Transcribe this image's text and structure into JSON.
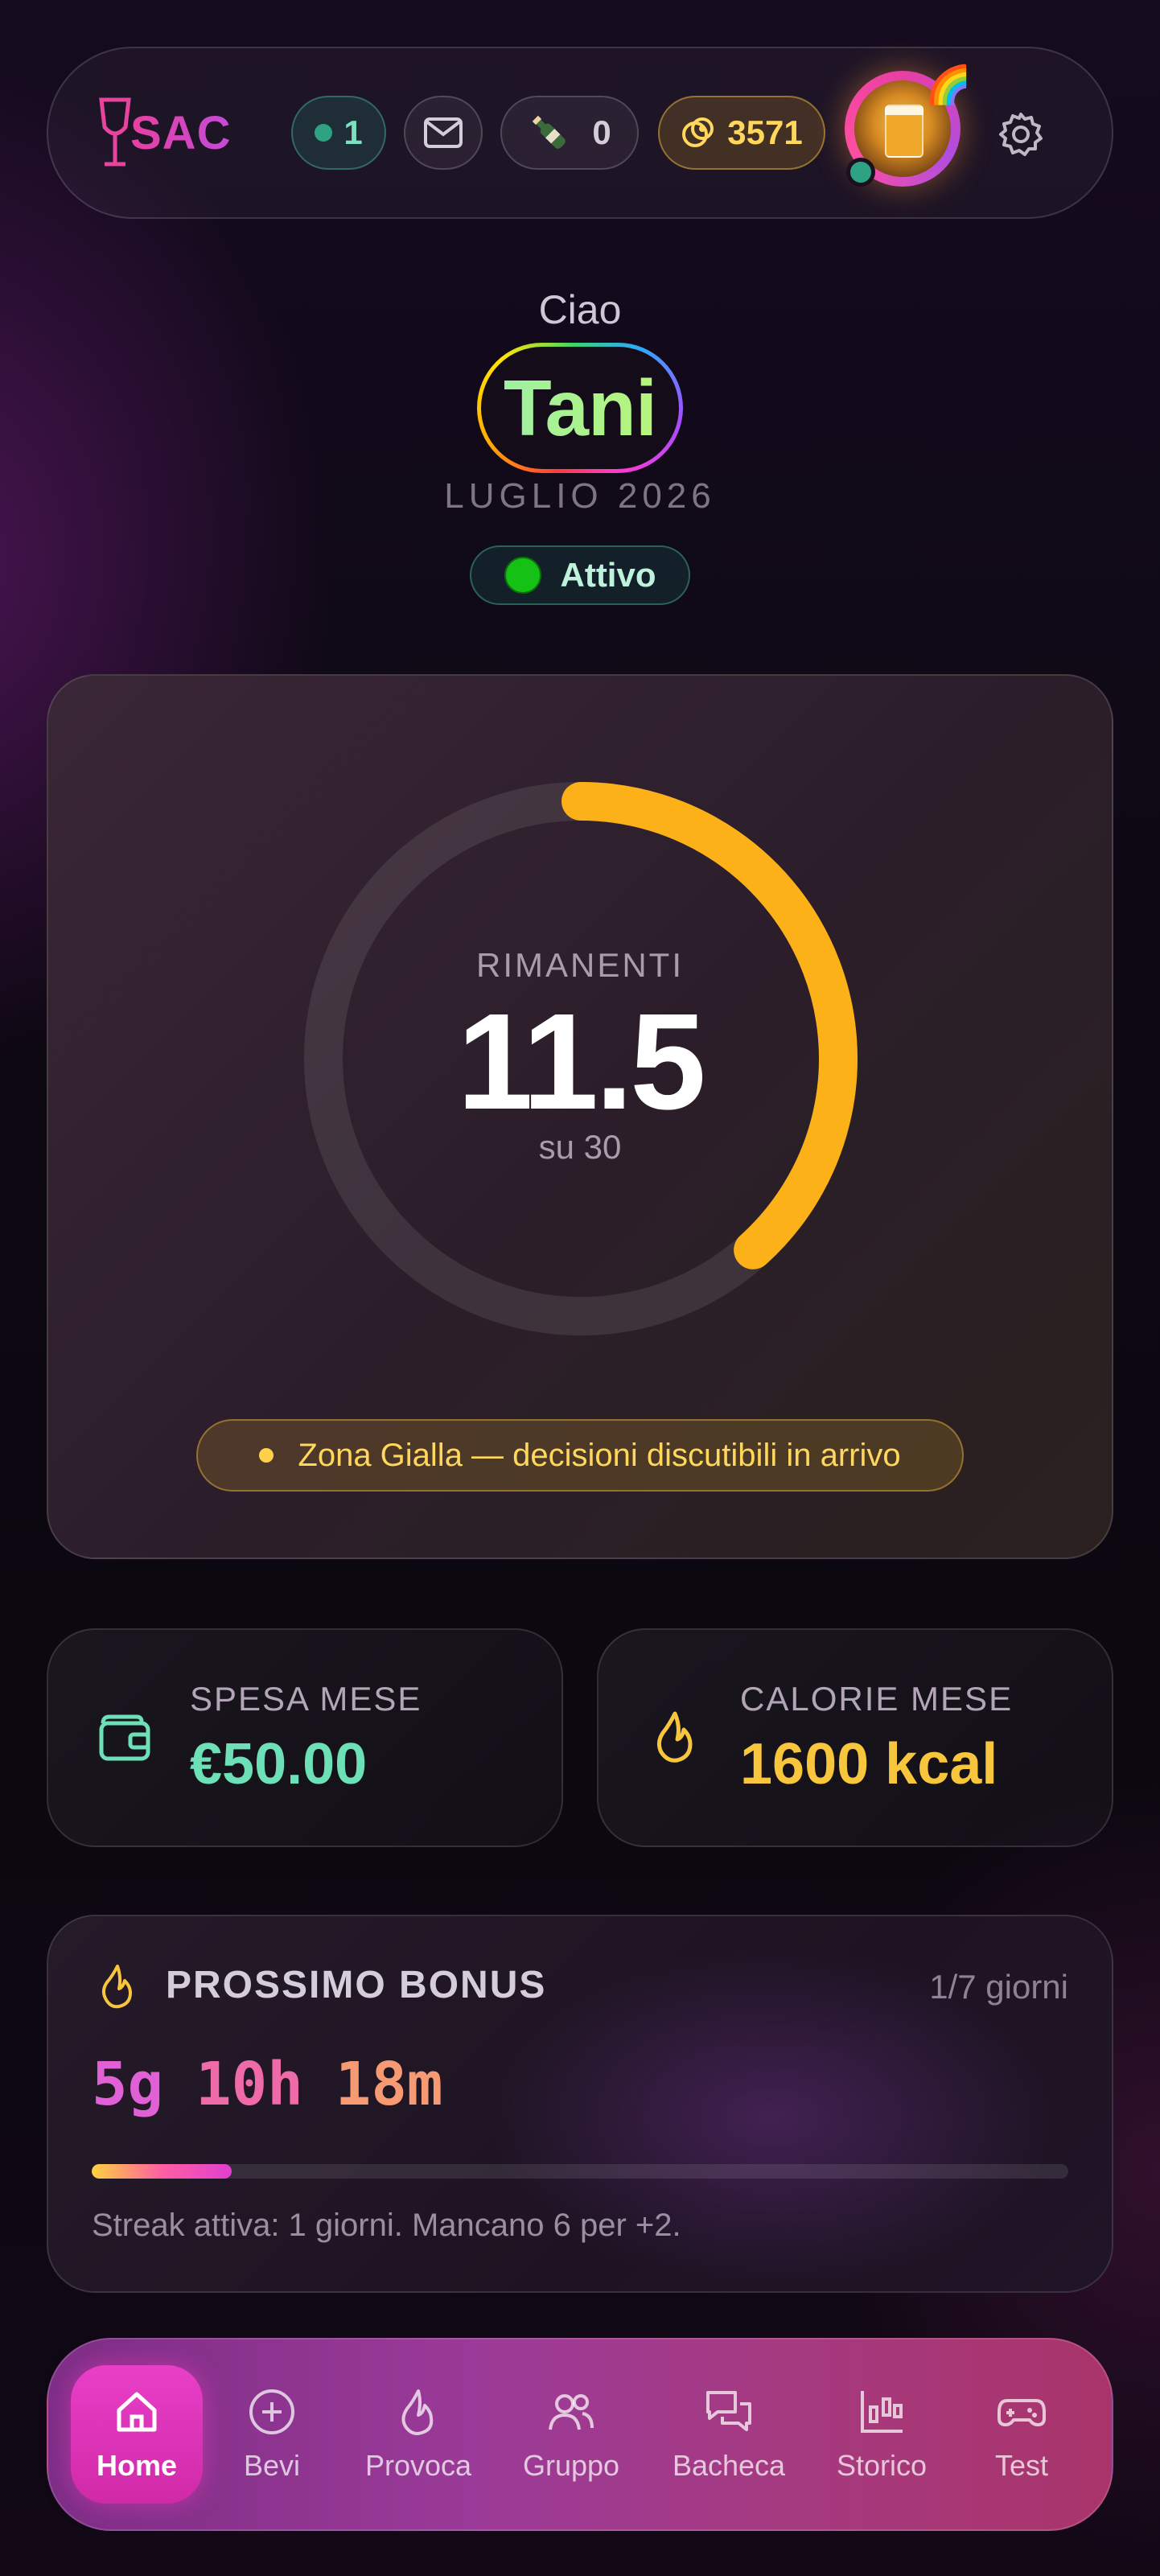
{
  "header": {
    "logo_text": "SAC",
    "online_count": "1",
    "bottle_count": "0",
    "coins": "3571",
    "avatar_emoji": "🌈"
  },
  "greeting": {
    "hello": "Ciao",
    "name": "Tani",
    "month": "LUGLIO 2026",
    "status": "Attivo"
  },
  "gauge": {
    "label": "RIMANENTI",
    "value": "11.5",
    "subtitle": "su 30",
    "remaining": 11.5,
    "total": 30,
    "color": "#fbb117"
  },
  "zone": {
    "text": "Zona Gialla — decisioni discutibili in arrivo"
  },
  "stats": {
    "spend_label": "SPESA MESE",
    "spend_value": "€50.00",
    "calories_label": "CALORIE MESE",
    "calories_value": "1600 kcal"
  },
  "bonus": {
    "title": "PROSSIMO BONUS",
    "days": "1/7 giorni",
    "days_d": "5g",
    "hours": "10h",
    "minutes": "18m",
    "progress": 0.143,
    "streak_text": "Streak attiva: 1 giorni. Mancano 6 per +2."
  },
  "nav": {
    "items": [
      {
        "label": "Home",
        "icon": "home-icon"
      },
      {
        "label": "Bevi",
        "icon": "plus-circle-icon"
      },
      {
        "label": "Provoca",
        "icon": "flame-icon"
      },
      {
        "label": "Gruppo",
        "icon": "users-icon"
      },
      {
        "label": "Bacheca",
        "icon": "chat-icon"
      },
      {
        "label": "Storico",
        "icon": "chart-icon"
      },
      {
        "label": "Test",
        "icon": "gamepad-icon"
      }
    ]
  }
}
